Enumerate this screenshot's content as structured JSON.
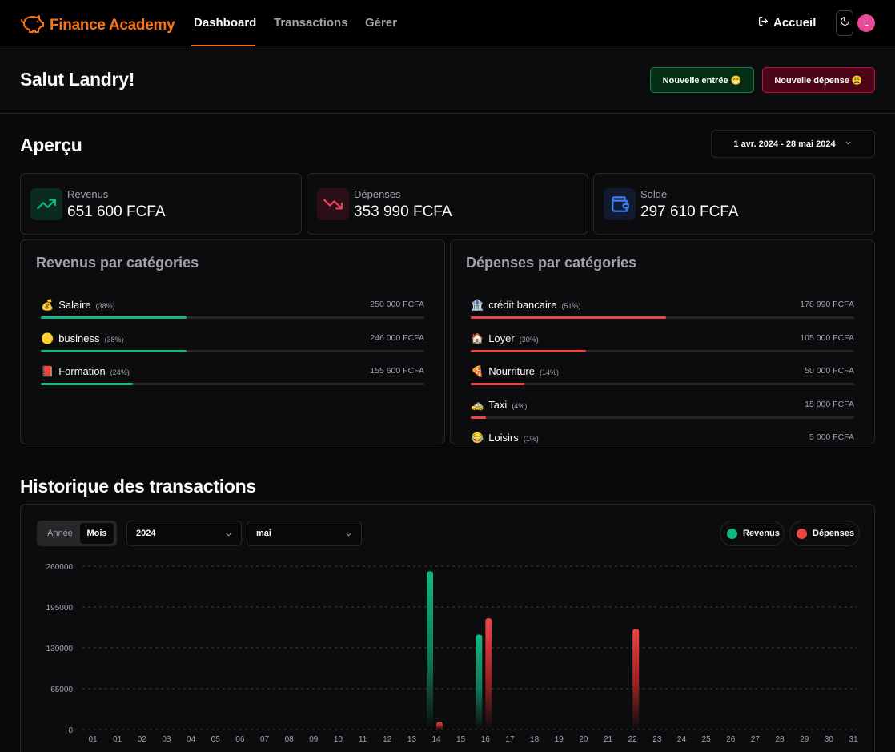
{
  "brand": {
    "name": "Finance Academy",
    "color": "#f97316"
  },
  "nav": {
    "links": [
      "Dashboard",
      "Transactions",
      "Gérer"
    ],
    "active": "Dashboard",
    "home": "Accueil",
    "avatar_initial": "L"
  },
  "header": {
    "greeting": "Salut Landry!",
    "new_entry": "Nouvelle entrée 😁",
    "new_expense": "Nouvelle dépense 😩"
  },
  "overview": {
    "title": "Aperçu",
    "date_range": "1 avr. 2024 - 28 mai 2024",
    "stats": [
      {
        "label": "Revenus",
        "value": "651 600 FCFA",
        "icon": "trending-up-icon",
        "color": "#10b981"
      },
      {
        "label": "Dépenses",
        "value": "353 990 FCFA",
        "icon": "trending-down-icon",
        "color": "#f43f5e"
      },
      {
        "label": "Solde",
        "value": "297 610 FCFA",
        "icon": "wallet-icon",
        "color": "#3b82f6"
      }
    ]
  },
  "income_categories": {
    "title": "Revenus par catégories",
    "color": "#10b981",
    "items": [
      {
        "emoji": "💰",
        "name": "Salaire",
        "pct_label": "(38%)",
        "amount": "250 000 FCFA",
        "pct": 38
      },
      {
        "emoji": "🟡",
        "name": "business",
        "pct_label": "(38%)",
        "amount": "246 000 FCFA",
        "pct": 38
      },
      {
        "emoji": "📕",
        "name": "Formation",
        "pct_label": "(24%)",
        "amount": "155 600 FCFA",
        "pct": 24
      }
    ]
  },
  "expense_categories": {
    "title": "Dépenses par catégories",
    "color": "#ef4444",
    "items": [
      {
        "emoji": "🏦",
        "name": "crédit bancaire",
        "pct_label": "(51%)",
        "amount": "178 990 FCFA",
        "pct": 51
      },
      {
        "emoji": "🏠",
        "name": "Loyer",
        "pct_label": "(30%)",
        "amount": "105 000 FCFA",
        "pct": 30
      },
      {
        "emoji": "🍕",
        "name": "Nourriture",
        "pct_label": "(14%)",
        "amount": "50 000 FCFA",
        "pct": 14
      },
      {
        "emoji": "🚕",
        "name": "Taxi",
        "pct_label": "(4%)",
        "amount": "15 000 FCFA",
        "pct": 4
      },
      {
        "emoji": "😂",
        "name": "Loisirs",
        "pct_label": "(1%)",
        "amount": "5 000 FCFA",
        "pct": 1
      }
    ]
  },
  "history": {
    "title": "Historique des transactions",
    "toggle": [
      "Année",
      "Mois"
    ],
    "toggle_active": "Mois",
    "year": "2024",
    "month": "mai",
    "legend": [
      {
        "name": "Revenus",
        "color": "#10b981"
      },
      {
        "name": "Dépenses",
        "color": "#ef4444"
      }
    ]
  },
  "chart_data": {
    "type": "bar",
    "ylim": [
      0,
      260000
    ],
    "yticks": [
      "0",
      "65000",
      "130000",
      "195000",
      "260000"
    ],
    "categories": [
      "01",
      "01",
      "02",
      "03",
      "04",
      "05",
      "06",
      "07",
      "08",
      "09",
      "10",
      "11",
      "12",
      "13",
      "14",
      "15",
      "16",
      "17",
      "18",
      "19",
      "20",
      "21",
      "22",
      "23",
      "24",
      "25",
      "26",
      "27",
      "28",
      "29",
      "30",
      "31"
    ],
    "series": [
      {
        "name": "Revenus",
        "values": [
          0,
          0,
          0,
          0,
          0,
          0,
          0,
          0,
          0,
          0,
          0,
          0,
          0,
          0,
          252000,
          0,
          151000,
          0,
          0,
          0,
          0,
          0,
          0,
          0,
          0,
          0,
          0,
          0,
          0,
          0,
          0,
          0
        ]
      },
      {
        "name": "Dépenses",
        "values": [
          0,
          0,
          0,
          0,
          0,
          0,
          0,
          0,
          0,
          0,
          0,
          0,
          0,
          0,
          12000,
          0,
          177000,
          0,
          0,
          0,
          0,
          0,
          160000,
          0,
          0,
          0,
          0,
          0,
          0,
          0,
          0,
          0
        ]
      }
    ]
  }
}
